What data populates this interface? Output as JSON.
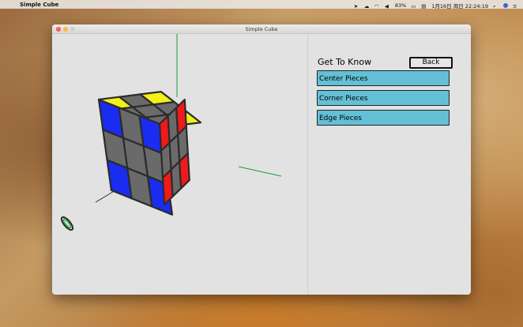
{
  "menubar": {
    "app_name": "Simple Cube",
    "battery": "83%",
    "datetime": "1月16日 周日  22:24:19"
  },
  "window": {
    "title": "Simple Cube"
  },
  "panel": {
    "title": "Get To Know",
    "back_label": "Back",
    "items": [
      {
        "label": "Center Pieces"
      },
      {
        "label": "Corner Pieces"
      },
      {
        "label": "Edge Pieces"
      }
    ]
  },
  "cube": {
    "top_face": [
      [
        "yellow",
        "gray",
        "yellow"
      ],
      [
        "gray",
        "gray",
        "gray"
      ],
      [
        "yellow",
        "gray",
        "yellow"
      ]
    ],
    "front_face": [
      [
        "blue",
        "gray",
        "blue"
      ],
      [
        "gray",
        "gray",
        "gray"
      ],
      [
        "blue",
        "gray",
        "blue"
      ]
    ],
    "right_face": [
      [
        "red",
        "gray",
        "red"
      ],
      [
        "gray",
        "gray",
        "gray"
      ],
      [
        "red",
        "gray",
        "red"
      ]
    ],
    "colors": {
      "yellow": "#f2ef1a",
      "blue": "#1a2cf0",
      "red": "#f01a1a",
      "gray": "#6a6a6a"
    }
  }
}
